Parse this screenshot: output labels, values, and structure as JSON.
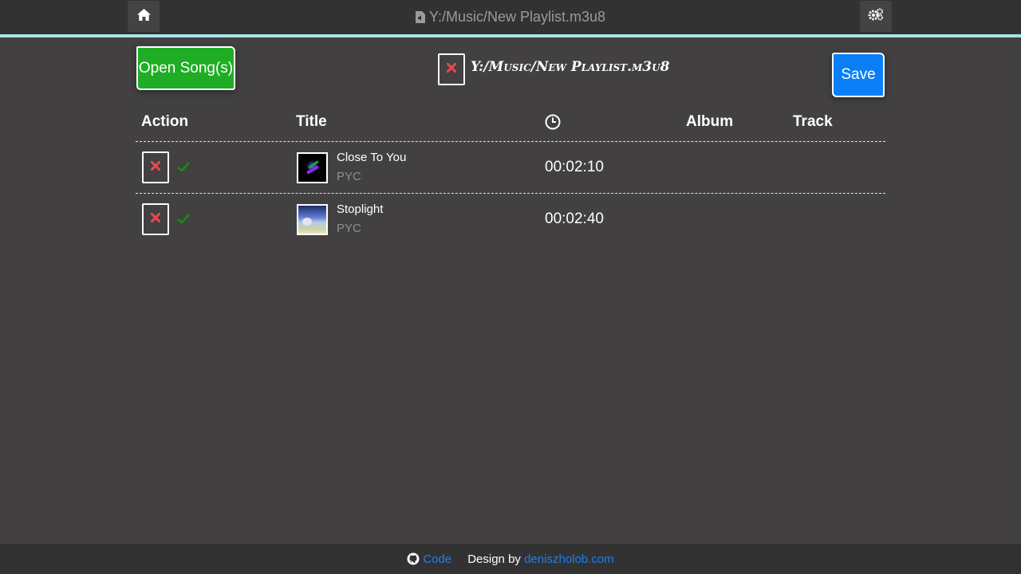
{
  "header": {
    "title": "Y:/Music/New Playlist.m3u8",
    "home_icon": "home-icon",
    "settings_icon": "cogs-icon",
    "accent_line_color": "#a9e3ea"
  },
  "toolbar": {
    "open_label": "Open Song(s)",
    "playlist_path": "Y:/Music/New Playlist.m3u8",
    "save_label": "Save"
  },
  "table": {
    "columns": [
      "Action",
      "Title",
      "",
      "Album",
      "Track"
    ],
    "duration_icon": "clock-icon",
    "rows": [
      {
        "title": "Close To You",
        "artist": "PYC",
        "duration": "00:02:10",
        "album": "",
        "track": ""
      },
      {
        "title": "Stoplight",
        "artist": "PYC",
        "duration": "00:02:40",
        "album": "",
        "track": ""
      }
    ]
  },
  "footer": {
    "code_label": "Code",
    "design_label": "Design by",
    "design_link": "deniszholob.com"
  },
  "colors": {
    "background": "#424040",
    "bar": "#333232",
    "open_button": "#1ead24",
    "save_button": "#0a7ff5",
    "remove_icon": "#e74c4c",
    "check_icon": "#1a8a1a",
    "link": "#1e7ef0"
  }
}
